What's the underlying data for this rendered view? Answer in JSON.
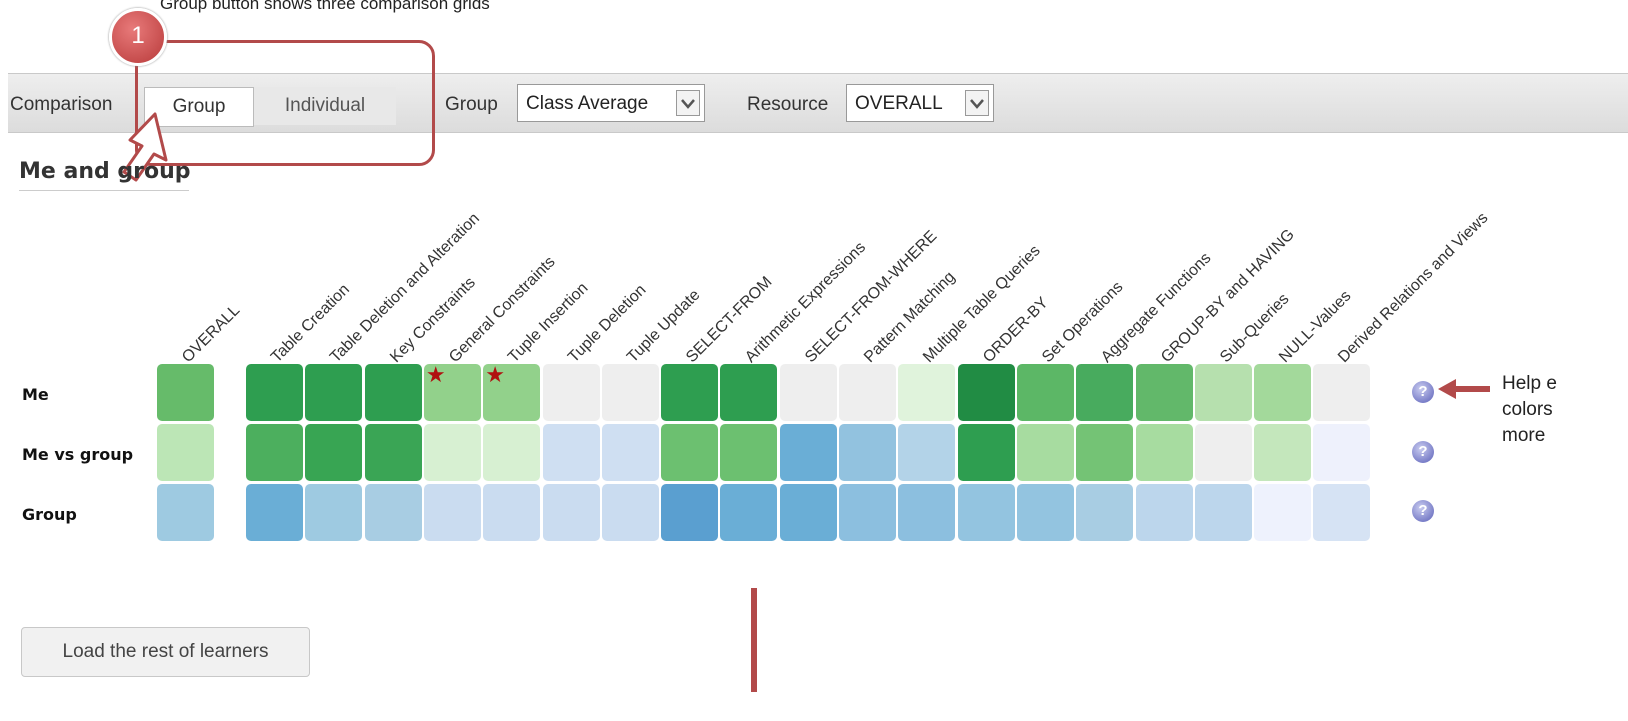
{
  "annotations": {
    "top_caption": "Group button shows three comparison grids",
    "badge_number": "1",
    "help_caption": [
      "Help e",
      "colors",
      "more"
    ]
  },
  "toolbar": {
    "comparison_label": "Comparison",
    "group_button": "Group",
    "individual_button": "Individual",
    "group_label": "Group",
    "group_select_value": "Class Average",
    "resource_label": "Resource",
    "resource_select_value": "OVERALL"
  },
  "section_title": "Me and group",
  "columns": [
    "OVERALL",
    "Table Creation",
    "Table Deletion and Alteration",
    "Key Constraints",
    "General Constraints",
    "Tuple Insertion",
    "Tuple Deletion",
    "Tuple Update",
    "SELECT-FROM",
    "Arithmetic Expressions",
    "SELECT-FROM-WHERE",
    "Pattern Matching",
    "Multiple Table Queries",
    "ORDER-BY",
    "Set Operations",
    "Aggregate Functions",
    "GROUP-BY and HAVING",
    "Sub-Queries",
    "NULL-Values",
    "Derived Relations and Views"
  ],
  "rows": [
    {
      "label": "Me",
      "colors": [
        "#66bb6a",
        "#2e9e50",
        "#2e9e50",
        "#2e9e50",
        "#92d18b",
        "#92d18b",
        "#eeeeee",
        "#eeeeee",
        "#2e9e50",
        "#2e9e50",
        "#eeeeee",
        "#eeeeee",
        "#e0f3dc",
        "#218c44",
        "#5cb766",
        "#48ab5e",
        "#62b86a",
        "#b6e0ae",
        "#a3d99b",
        "#eeeeee"
      ],
      "stars": [
        4,
        5
      ]
    },
    {
      "label": "Me vs group",
      "colors": [
        "#bce6b6",
        "#4caf5e",
        "#38a553",
        "#3aa555",
        "#d7f0d2",
        "#d7f0d2",
        "#cfdff2",
        "#cfdff2",
        "#6cc070",
        "#6cc070",
        "#6aaed6",
        "#92c2df",
        "#b3d3e8",
        "#2e9e50",
        "#a7dca0",
        "#74c375",
        "#a7dca0",
        "#eeeeee",
        "#c4e7bc",
        "#eef1fc"
      ],
      "stars": []
    },
    {
      "label": "Group",
      "colors": [
        "#9ecae1",
        "#6aaed6",
        "#9ecae1",
        "#a8cde3",
        "#cadcf0",
        "#cadcf0",
        "#cadcf0",
        "#cadcf0",
        "#5a9fd0",
        "#6aaed6",
        "#6aaed6",
        "#8cbfdf",
        "#8cbfdf",
        "#93c4e0",
        "#93c4e0",
        "#a8cde3",
        "#bcd6ec",
        "#bcd6ec",
        "#eef2fd",
        "#d6e3f4"
      ],
      "stars": []
    }
  ],
  "help_icon_glyph": "?",
  "load_button": "Load the rest of learners",
  "icons": {
    "help": "question-circle-icon",
    "star": "star-icon",
    "arrow": "pointer-arrow-icon"
  }
}
